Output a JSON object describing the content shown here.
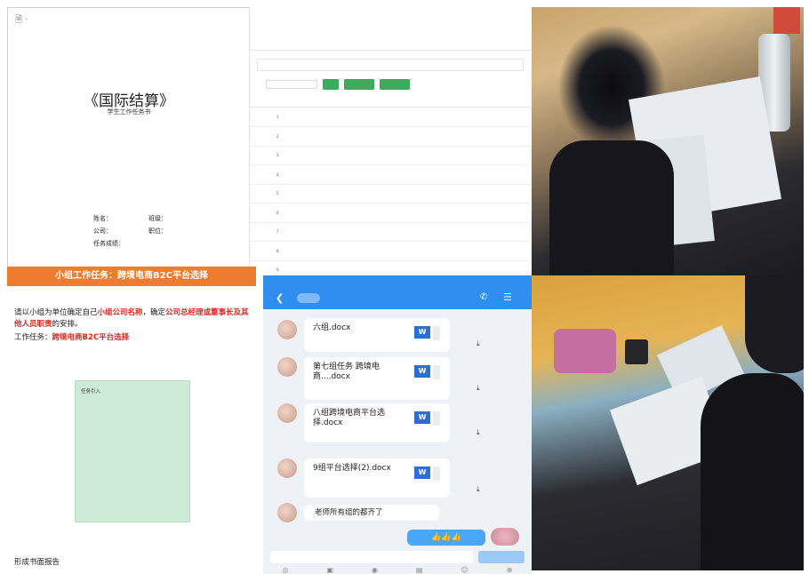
{
  "document": {
    "corner_mark": "",
    "title": "《国际结算》",
    "subtitle": "学生工作任务书",
    "fields": {
      "name_label": "姓名：",
      "class_label": "班级：",
      "company_label": "公司：",
      "position_label": "职位：",
      "score_label": "任务成绩："
    }
  },
  "table_panel": {
    "breadcrumb": "",
    "tabs": [
      "",
      "",
      "",
      "",
      ""
    ],
    "section_title": "",
    "search_label": "",
    "search_placeholder": "",
    "buttons": [
      "",
      "",
      ""
    ],
    "headers": [
      "",
      "",
      "",
      "",
      "",
      ""
    ],
    "rows": [
      [
        "1",
        "",
        "",
        "",
        "",
        ""
      ],
      [
        "2",
        "",
        "",
        "",
        "",
        ""
      ],
      [
        "3",
        "",
        "",
        "",
        "",
        ""
      ],
      [
        "4",
        "",
        "",
        "",
        "",
        ""
      ],
      [
        "5",
        "",
        "",
        "",
        "",
        ""
      ],
      [
        "6",
        "",
        "",
        "",
        "",
        ""
      ],
      [
        "7",
        "",
        "",
        "",
        "",
        ""
      ],
      [
        "8",
        "",
        "",
        "",
        "",
        ""
      ],
      [
        "9",
        "",
        "",
        "",
        "",
        ""
      ]
    ]
  },
  "task": {
    "banner": "小组工作任务：跨境电商B2C平台选择",
    "para1_a": "请以小组为单位确定自己",
    "para1_red1": "小组公司名称",
    "para1_b": "，确定",
    "para1_red2": "公司总经理或董事长及其他人员职责",
    "para1_c": "的安排。",
    "para2_a": "工作任务：",
    "para2_red": "跨境电商B2C平台选择",
    "card_title": "任务引入",
    "card_lines": [
      "",
      "",
      "",
      "",
      "",
      "",
      "",
      ""
    ],
    "footer": "形成书面报告"
  },
  "chat": {
    "status_text": "",
    "name": "",
    "files": [
      {
        "name": "六组.docx",
        "meta": ""
      },
      {
        "name": "第七组任务 跨境电商....docx",
        "meta": ""
      },
      {
        "name": "八组跨境电商平台选择.docx",
        "meta": ""
      },
      {
        "name": "9组平台选择(2).docx",
        "meta": ""
      }
    ],
    "time_divider": "",
    "text_message": "老师所有组的都齐了",
    "my_message": "👍👍👍",
    "send_label": ""
  }
}
